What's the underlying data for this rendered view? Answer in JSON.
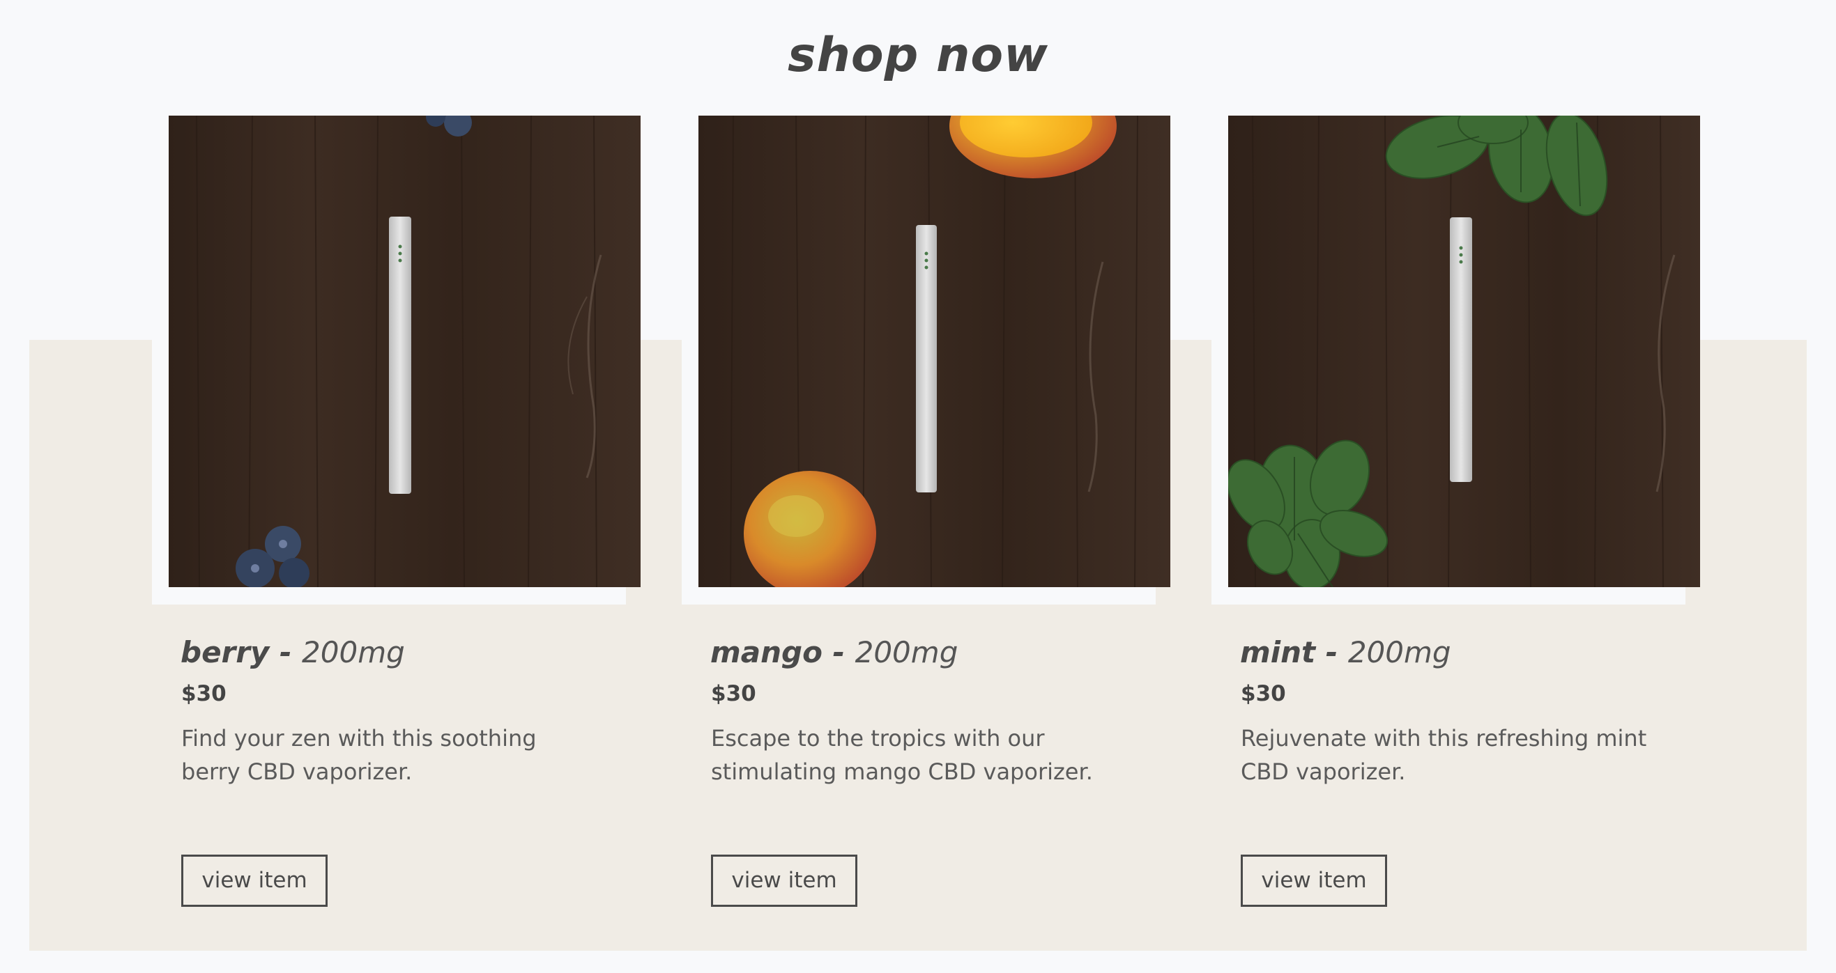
{
  "section": {
    "title": "shop now"
  },
  "products": [
    {
      "name": "berry -",
      "dose": "200mg",
      "price": "$30",
      "description": "Find your zen with this soothing berry CBD vaporizer.",
      "button_label": "view item",
      "image_icon": "berry-vaporizer-photo"
    },
    {
      "name": "mango -",
      "dose": "200mg",
      "price": "$30",
      "description": "Escape to the tropics with our stimulating mango CBD vaporizer.",
      "button_label": "view item",
      "image_icon": "mango-vaporizer-photo"
    },
    {
      "name": "mint -",
      "dose": "200mg",
      "price": "$30",
      "description": "Rejuvenate with this refreshing mint CBD vaporizer.",
      "button_label": "view item",
      "image_icon": "mint-vaporizer-photo"
    }
  ],
  "colors": {
    "page_background": "#f8f9fb",
    "band_background": "#f0ece5",
    "wood": "#3b2b22",
    "text": "#4a4a4a"
  }
}
